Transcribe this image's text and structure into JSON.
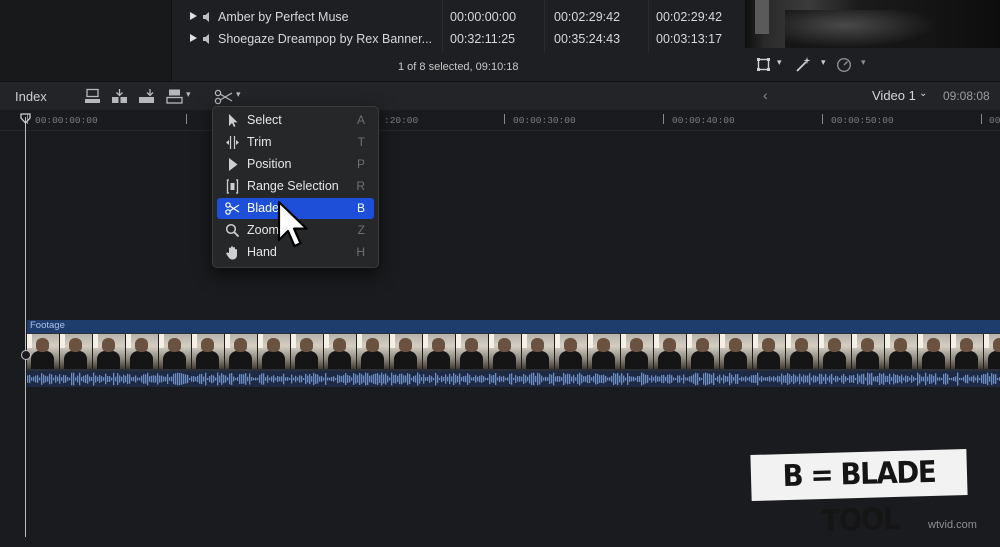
{
  "browser": {
    "rows": [
      {
        "name": "Amber by Perfect Muse",
        "start": "00:00:00:00",
        "end": "00:02:29:42",
        "duration": "00:02:29:42"
      },
      {
        "name": "Shoegaze Dreampop by Rex Banner...",
        "start": "00:32:11:25",
        "end": "00:35:24:43",
        "duration": "00:03:13:17"
      }
    ],
    "status": "1 of 8 selected, 09:10:18"
  },
  "timeline": {
    "index_label": "Index",
    "video_label": "Video 1",
    "duration": "09:08:08",
    "ruler": [
      {
        "label": "00:00:00:00"
      },
      {
        "label": ":20:00"
      },
      {
        "label": "00:00:30:00"
      },
      {
        "label": "00:00:40:00"
      },
      {
        "label": "00:00:50:00"
      },
      {
        "label": "00:0"
      }
    ],
    "clip_name": "Footage"
  },
  "tool_menu": {
    "items": [
      {
        "label": "Select",
        "shortcut": "A",
        "icon": "arrow-pointer-icon",
        "selected": false
      },
      {
        "label": "Trim",
        "shortcut": "T",
        "icon": "trim-icon",
        "selected": false
      },
      {
        "label": "Position",
        "shortcut": "P",
        "icon": "position-arrow-icon",
        "selected": false
      },
      {
        "label": "Range Selection",
        "shortcut": "R",
        "icon": "range-selection-icon",
        "selected": false
      },
      {
        "label": "Blade",
        "shortcut": "B",
        "icon": "scissors-icon",
        "selected": true
      },
      {
        "label": "Zoom",
        "shortcut": "Z",
        "icon": "magnifier-icon",
        "selected": false
      },
      {
        "label": "Hand",
        "shortcut": "H",
        "icon": "hand-icon",
        "selected": false
      }
    ]
  },
  "overlay_label": "B = BLADE TOOL",
  "watermark": "wtvid.com",
  "colors": {
    "menu_highlight": "#1d4fd8",
    "clip_header": "#1e3d6d",
    "audio_wave": "#6f8fc4"
  }
}
